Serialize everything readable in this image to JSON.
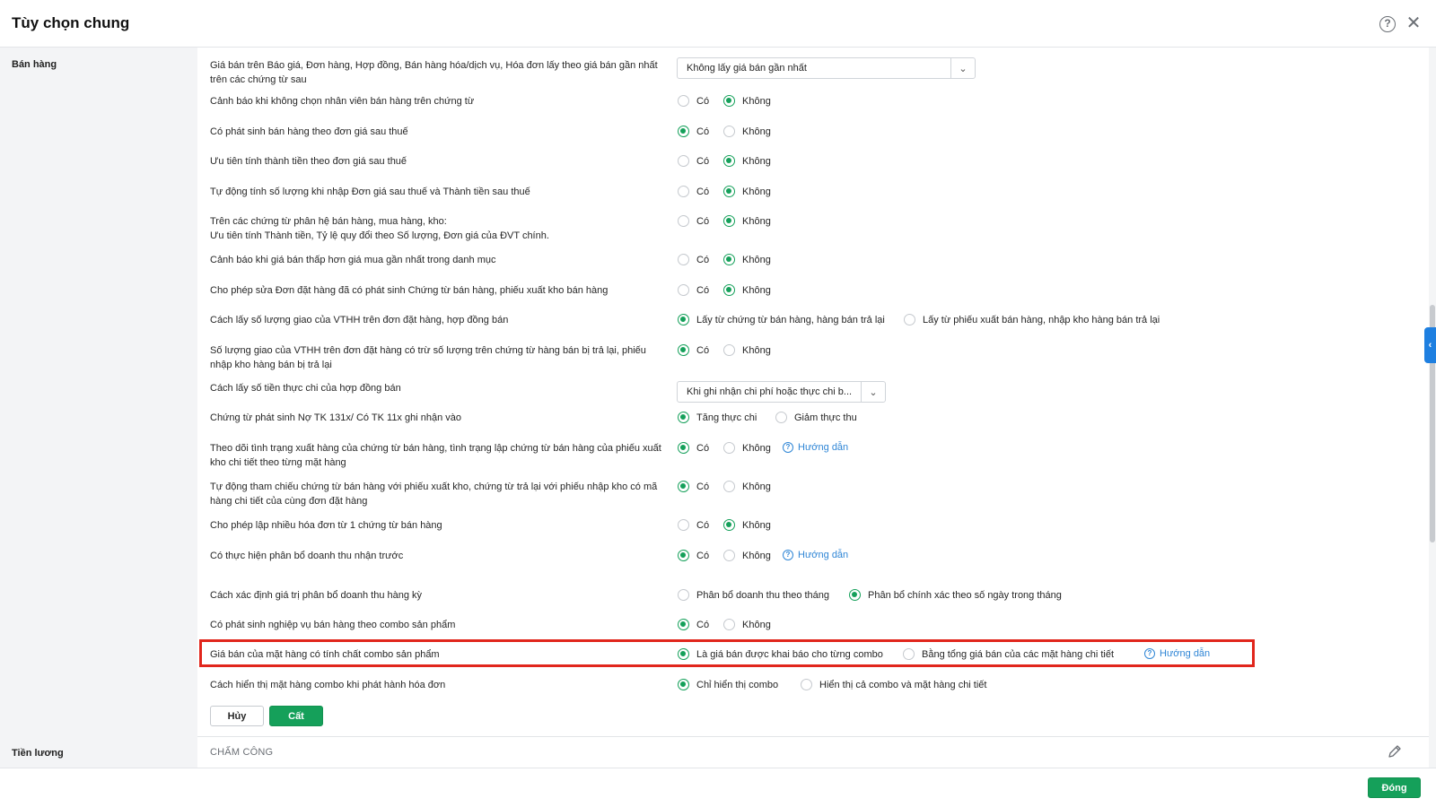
{
  "header": {
    "title": "Tùy chọn chung",
    "help_glyph": "?",
    "close_glyph": "✕"
  },
  "sections": {
    "sales": "Bán hàng",
    "payroll": "Tiền lương"
  },
  "rows": [
    {
      "label": [
        "Giá bán trên Báo giá, Đơn hàng, Hợp đồng, Bán hàng hóa/dịch vụ, Hóa đơn lấy theo giá bán gần nhất",
        "trên các chứng từ sau"
      ],
      "select": "Không lấy giá bán gần nhất"
    },
    {
      "label": [
        "Cảnh báo khi không chọn nhân viên bán hàng trên chứng từ"
      ],
      "options": [
        "Có",
        "Không"
      ],
      "selected": 1
    },
    {
      "label": [
        "Có phát sinh bán hàng theo đơn giá sau thuế"
      ],
      "options": [
        "Có",
        "Không"
      ],
      "selected": 0
    },
    {
      "label": [
        "Ưu tiên tính thành tiền theo đơn giá sau thuế"
      ],
      "options": [
        "Có",
        "Không"
      ],
      "selected": 1
    },
    {
      "label": [
        "Tự động tính số lượng khi nhập Đơn giá sau thuế và Thành tiền sau thuế"
      ],
      "options": [
        "Có",
        "Không"
      ],
      "selected": 1
    },
    {
      "label": [
        "Trên các chứng từ phân hệ bán hàng, mua hàng, kho:",
        "Ưu tiên tính Thành tiền, Tỷ lệ quy đổi theo Số lượng, Đơn giá của ĐVT chính."
      ],
      "options": [
        "Có",
        "Không"
      ],
      "selected": 1
    },
    {
      "label": [
        "Cảnh báo khi giá bán thấp hơn giá mua gần nhất trong danh mục"
      ],
      "options": [
        "Có",
        "Không"
      ],
      "selected": 1
    },
    {
      "label": [
        "Cho phép sửa Đơn đặt hàng đã có phát sinh Chứng từ bán hàng, phiếu xuất kho bán hàng"
      ],
      "options": [
        "Có",
        "Không"
      ],
      "selected": 1
    },
    {
      "label": [
        "Cách lấy số lượng giao của VTHH trên đơn đặt hàng, hợp đồng bán"
      ],
      "options": [
        "Lấy từ chứng từ bán hàng, hàng bán trả lại",
        "Lấy từ phiếu xuất bán hàng, nhập kho hàng bán trả lại"
      ],
      "selected": 0
    },
    {
      "label": [
        "Số lượng giao của VTHH trên đơn đặt hàng có trừ số lượng trên chứng từ hàng bán bị trả lại, phiếu",
        "nhập kho hàng bán bị trả lại"
      ],
      "options": [
        "Có",
        "Không"
      ],
      "selected": 0
    },
    {
      "label": [
        "Cách lấy số tiền thực chi của hợp đồng bán"
      ],
      "select": "Khi ghi nhận chi phí hoặc thực chi b..."
    },
    {
      "label": [
        "Chứng từ phát sinh Nợ TK 131x/ Có TK 11x ghi nhận vào"
      ],
      "options": [
        "Tăng thực chi",
        "Giảm thực thu"
      ],
      "selected": 0
    },
    {
      "label": [
        "Theo dõi tình trạng xuất hàng của chứng từ bán hàng, tình trạng lập chứng từ bán hàng của phiếu xuất",
        "kho chi tiết theo từng mặt hàng"
      ],
      "options": [
        "Có",
        "Không"
      ],
      "selected": 0,
      "guide": "Hướng dẫn"
    },
    {
      "label": [
        "Tự động tham chiếu chứng từ bán hàng với phiếu xuất kho, chứng từ trả lại với phiếu nhập kho có mã",
        "hàng chi tiết của cùng đơn đặt hàng"
      ],
      "options": [
        "Có",
        "Không"
      ],
      "selected": 0
    },
    {
      "label": [
        "Cho phép lập nhiều hóa đơn từ 1 chứng từ bán hàng"
      ],
      "options": [
        "Có",
        "Không"
      ],
      "selected": 1
    },
    {
      "label": [
        "Có thực hiện phân bổ doanh thu nhận trước"
      ],
      "options": [
        "Có",
        "Không"
      ],
      "selected": 0,
      "guide": "Hướng dẫn"
    },
    {
      "label": [
        "Cách xác định giá trị phân bổ doanh thu hàng kỳ"
      ],
      "options": [
        "Phân bổ doanh thu theo tháng",
        "Phân bổ chính xác theo số ngày trong tháng"
      ],
      "selected": 1
    },
    {
      "label": [
        "Có phát sinh nghiệp vụ bán hàng theo combo sản phẩm"
      ],
      "options": [
        "Có",
        "Không"
      ],
      "selected": 0
    },
    {
      "label": [
        "Giá bán của mặt hàng có tính chất combo sản phẩm"
      ],
      "options": [
        "Là giá bán được khai báo cho từng combo",
        "Bằng tổng giá bán của các mặt hàng chi tiết"
      ],
      "selected": 0,
      "guide": "Hướng dẫn"
    },
    {
      "label": [
        "Cách hiển thị mặt hàng combo khi phát hành hóa đơn"
      ],
      "options": [
        "Chỉ hiển thị combo",
        "Hiển thị cả combo và mặt hàng chi tiết"
      ],
      "selected": 0
    }
  ],
  "buttons": {
    "cancel": "Hủy",
    "save": "Cất",
    "close": "Đóng"
  },
  "payroll": {
    "subheader": "CHẤM CÔNG"
  },
  "side_toggle_glyph": "‹",
  "select_arrow_glyph": "⌄",
  "guide_glyph": "?",
  "colors": {
    "accent": "#15a05a",
    "link": "#2f86d6",
    "highlight": "#e1261c",
    "toggle": "#1e7fe0"
  }
}
